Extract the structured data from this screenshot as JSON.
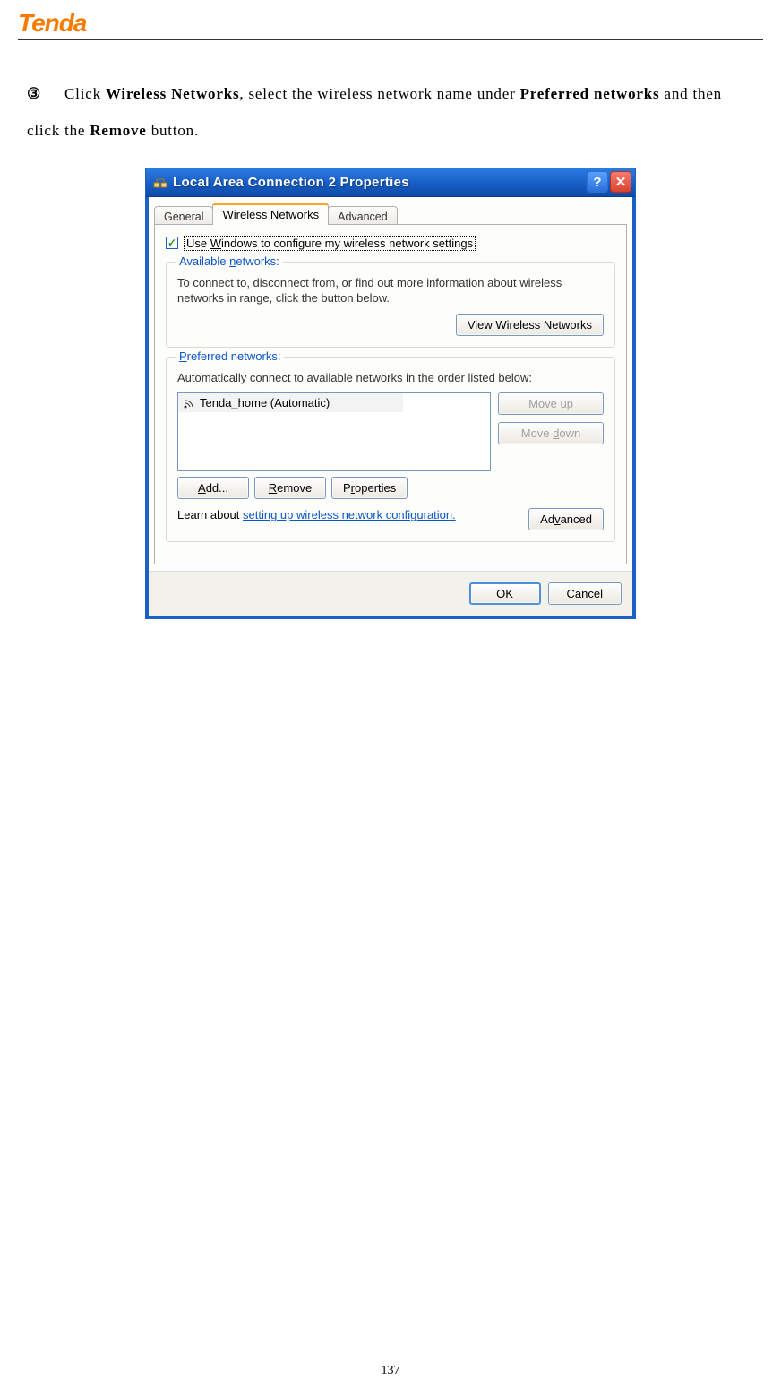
{
  "header": {
    "logo": "Tenda"
  },
  "instruction": {
    "step_marker": "③",
    "pre1": "Click ",
    "bold1": "Wireless Networks",
    "mid1": ", select the wireless network name under ",
    "bold2": "Preferred networks",
    "mid2": " and then click the ",
    "bold3": "Remove",
    "post": " button."
  },
  "dialog": {
    "title": "Local Area Connection 2 Properties",
    "help_symbol": "?",
    "close_symbol": "✕",
    "tabs": {
      "general": "General",
      "wireless": "Wireless Networks",
      "advanced": "Advanced"
    },
    "checkbox_pre": "Use ",
    "checkbox_u": "W",
    "checkbox_post": "indows to configure my wireless network settings",
    "checkbox_mark": "✓",
    "available": {
      "title_pre": "Available ",
      "title_u": "n",
      "title_post": "etworks:",
      "text": "To connect to, disconnect from, or find out more information about wireless networks in range, click the button below.",
      "btn": "View Wireless Networks"
    },
    "preferred": {
      "title_pre": "",
      "title_u": "P",
      "title_post": "referred networks:",
      "text": "Automatically connect to available networks in the order listed below:",
      "item": "Tenda_home (Automatic)",
      "moveup_pre": "Move ",
      "moveup_u": "u",
      "moveup_post": "p",
      "movedown_pre": "Move ",
      "movedown_u": "d",
      "movedown_post": "own",
      "add_u": "A",
      "add_post": "dd...",
      "remove_u": "R",
      "remove_post": "emove",
      "props_pre": "P",
      "props_u": "r",
      "props_post": "operties",
      "learn_pre": "Learn about ",
      "learn_link": "setting up wireless network configuration.",
      "adv_pre": "Ad",
      "adv_u": "v",
      "adv_post": "anced"
    },
    "footer": {
      "ok": "OK",
      "cancel": "Cancel"
    }
  },
  "page_number": "137"
}
